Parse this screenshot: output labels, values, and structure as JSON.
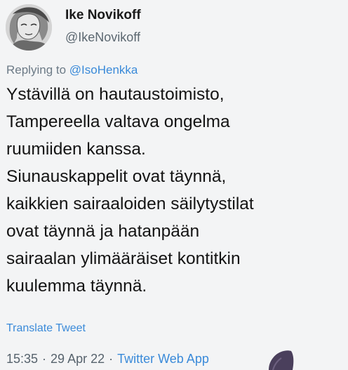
{
  "author": {
    "display_name": "Ike Novikoff",
    "handle": "@IkeNovikoff",
    "avatar_icon": "user-avatar-sketch"
  },
  "reply": {
    "prefix": "Replying to ",
    "mention": "@IsoHenkka"
  },
  "tweet": {
    "lines": [
      "Ystävillä on hautaustoimisto,",
      "Tampereella valtava ongelma",
      "ruumiiden kanssa.",
      "Siunauskappelit ovat täynnä,",
      "kaikkien sairaaloiden säilytystilat",
      "ovat täynnä ja hatanpään",
      "sairaalan ylimääräiset kontitkin",
      "kuulemma täynnä."
    ],
    "translate_label": "Translate Tweet"
  },
  "meta": {
    "time": "15:35",
    "separator": "·",
    "date": "29 Apr 22",
    "source": "Twitter Web App"
  },
  "colors": {
    "link": "#3a8ad9",
    "text": "#141414",
    "muted": "#57636d",
    "background": "#f3f4f5"
  }
}
